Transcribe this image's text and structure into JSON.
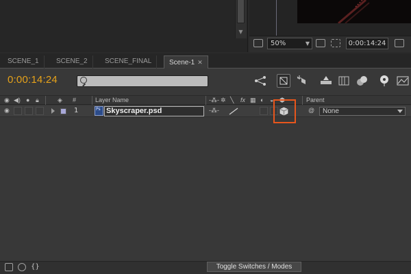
{
  "viewer": {
    "zoom": "50%",
    "timecode": "0:00:14:24"
  },
  "tabs": [
    {
      "label": "SCENE_1"
    },
    {
      "label": "SCENE_2"
    },
    {
      "label": "SCENE_FINAL"
    },
    {
      "label": "Scene-1",
      "active": true
    }
  ],
  "timeline": {
    "current_time": "0:00:14:24",
    "search_value": "",
    "columns": {
      "number": "#",
      "layer_name": "Layer Name",
      "parent": "Parent"
    },
    "layers": [
      {
        "number": "1",
        "name": "Skyscraper.psd",
        "parent": "None",
        "file_type": "Ps"
      }
    ],
    "toggle_button": "Toggle Switches / Modes"
  },
  "colors": {
    "timecode": "#e6a21a",
    "highlight": "#e8561c",
    "label_swatch": "#a8a8d8"
  }
}
